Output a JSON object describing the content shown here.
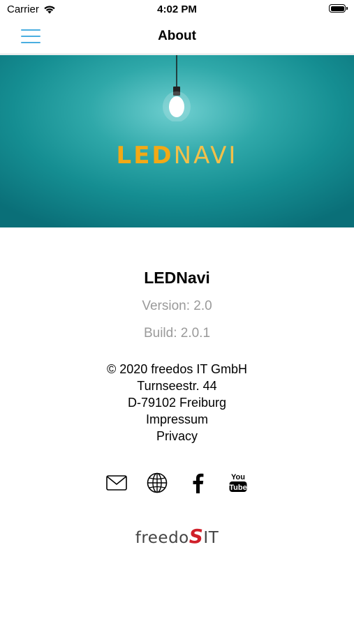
{
  "status_bar": {
    "carrier": "Carrier",
    "time": "4:02 PM"
  },
  "nav": {
    "title": "About"
  },
  "hero": {
    "logo_part1": "LED",
    "logo_part2": "NAVI"
  },
  "info": {
    "app_name": "LEDNavi",
    "version": "Version: 2.0",
    "build": "Build: 2.0.1"
  },
  "address": {
    "copyright": "© 2020 freedos IT GmbH",
    "street": "Turnseestr. 44",
    "city": "D-79102 Freiburg",
    "impressum": "Impressum",
    "privacy": "Privacy"
  },
  "social": {
    "youtube_text_top": "You",
    "youtube_text_bottom": "Tube"
  },
  "footer": {
    "logo_part1": "freedo",
    "logo_s": "S",
    "logo_part2": "IT"
  },
  "colors": {
    "accent": "#4aaee0",
    "hero_teal": "#158e92",
    "logo_orange": "#f2a916",
    "logo_red": "#d0202a"
  }
}
